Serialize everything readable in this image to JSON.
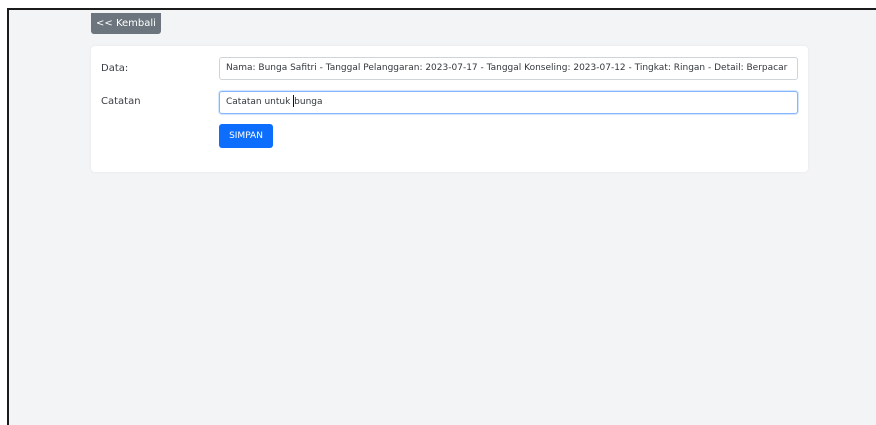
{
  "toolbar": {
    "back_label": "<< Kembali"
  },
  "form": {
    "data_label": "Data:",
    "data_value": "Nama: Bunga Safitri - Tanggal Pelanggaran: 2023-07-17 - Tanggal Konseling: 2023-07-12 - Tingkat: Ringan - Detail: Berpacar",
    "notes_label": "Catatan",
    "notes_value_before_caret": "Catatan untuk ",
    "notes_value_after_caret": "bunga",
    "save_label": "SIMPAN"
  },
  "colors": {
    "page_background": "#f3f4f6",
    "back_button": "#6c757d",
    "primary_button": "#0d6efd",
    "focus_border": "#86b7fe"
  }
}
